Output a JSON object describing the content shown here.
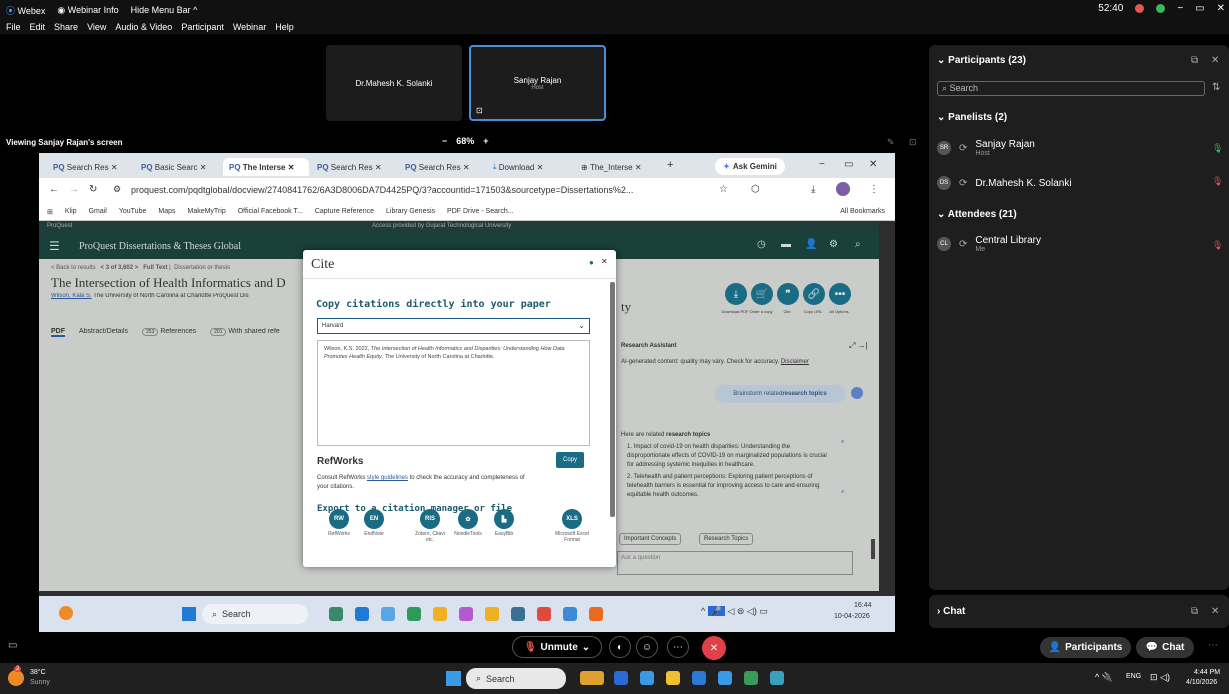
{
  "titlebar": {
    "app": "Webex",
    "webinar_info": "Webinar Info",
    "hide_menu": "Hide Menu Bar ^",
    "timer": "52:40"
  },
  "menubar": [
    "File",
    "Edit",
    "Share",
    "View",
    "Audio & Video",
    "Participant",
    "Webinar",
    "Help"
  ],
  "tiles": [
    {
      "name": "Dr.Mahesh K. Solanki",
      "role": ""
    },
    {
      "name": "Sanjay Rajan",
      "role": "Host"
    }
  ],
  "viewing": "Viewing Sanjay Rajan's screen",
  "zoom": {
    "minus": "−",
    "value": "68%",
    "plus": "+"
  },
  "browser": {
    "tabs": [
      "Search Res",
      "Basic Searc",
      "The Interse",
      "Search Res",
      "Search Res",
      "Download",
      "The_Interse"
    ],
    "ask_gemini": "Ask Gemini",
    "url": "proquest.com/pqdtglobal/docview/2740841762/6A3D8006DA7D4425PQ/3?accountid=171503&sourcetype=Dissertations%2...",
    "bookmarks": [
      "Klip",
      "Gmail",
      "YouTube",
      "Maps",
      "MakeMyTrip",
      "Official Facebook T...",
      "Capture Reference",
      "Library Genesis",
      "PDF Drive - Search..."
    ],
    "all_bookmarks": "All Bookmarks"
  },
  "proquest": {
    "brand": "ProQuest",
    "access": "Access provided by Gujarat Technological University",
    "nav_title": "ProQuest Dissertations & Theses Global",
    "back": "< Back to results",
    "pager": "< 3 of 3,602 >",
    "fulltext": "Full Text",
    "doctype": "Dissertation or thesis",
    "title": "The Intersection of Health Informatics and D",
    "title_tail": "ty",
    "author": "Wilson, Kala S.",
    "author_tail": "The University of North Carolina at Charlotte ProQuest Dis",
    "tabs": [
      "PDF",
      "Abstract/Details",
      "References",
      "With shared refe"
    ],
    "ref_count": "253",
    "shared_count": "201",
    "actions": [
      "Download PDF",
      "Order a copy",
      "Cite",
      "Copy URL",
      "All Options"
    ],
    "ra_title": "Research Assistant",
    "ra_note": "AI-generated content: quality may vary. Check for accuracy.",
    "ra_disclaimer": "Disclaimer",
    "brainstorm_prefix": "Brainstorm related ",
    "brainstorm_bold": "research topics",
    "related_prefix": "Here are related ",
    "related_bold": "research topics",
    "topic1": "1. Impact of covid-19 on health disparities: Understanding the disproportionate effects of COVID-19 on marginalized populations is crucial for addressing systemic inequities in healthcare.",
    "topic2": "2. Telehealth and patient perceptions: Exploring patient perceptions of telehealth barriers is essential for improving access to care and ensuring equitable health outcomes.",
    "chip1": "Important Concepts",
    "chip2": "Research Topics",
    "ask": "Ask a question"
  },
  "cite": {
    "title": "Cite",
    "heading": "Copy citations directly into your paper",
    "style": "Harvard",
    "citation_pre": "Wilson, K.S. 2022, ",
    "citation_title": "The Intersection of Health Informatics and Disparities: Understanding How Data Promotes Health Equity",
    "citation_post": ", The University of North Carolina at Charlotte.",
    "refworks": "RefWorks",
    "copy": "Copy",
    "consult_a": "Consult RefWorks ",
    "consult_link": "style guidelines",
    "consult_b": " to check the accuracy and completeness of your citations.",
    "export_heading": "Export to a citation manager or file",
    "export": [
      {
        "icon": "RW",
        "label": "RefWorks"
      },
      {
        "icon": "EN",
        "label": "EndNote"
      },
      {
        "icon": "RIS",
        "label": "Zotero, Citavi etc."
      },
      {
        "icon": "",
        "label": "NoodleTools"
      },
      {
        "icon": "",
        "label": "EasyBib"
      },
      {
        "icon": "XLS",
        "label": "Microsoft Excel Format"
      }
    ]
  },
  "innertaskbar": {
    "search": "Search",
    "time": "16:44",
    "date": "10-04-2026"
  },
  "rightpanel": {
    "participants": "Participants (23)",
    "search": "Search",
    "panelists": "Panelists (2)",
    "p1_name": "Sanjay Rajan",
    "p1_role": "Host",
    "p1_initials": "SR",
    "p2_name": "Dr.Mahesh K. Solanki",
    "p2_initials": "DS",
    "attendees": "Attendees (21)",
    "a1_name": "Central Library",
    "a1_role": "Me",
    "a1_initials": "CL",
    "chat": "Chat"
  },
  "controls": {
    "unmute": "Unmute",
    "participants": "Participants",
    "chat": "Chat"
  },
  "taskbar": {
    "temp": "38°C",
    "weather": "Sunny",
    "search": "Search",
    "lang": "ENG",
    "time": "4:44 PM",
    "date": "4/10/2026",
    "badge": "2"
  }
}
